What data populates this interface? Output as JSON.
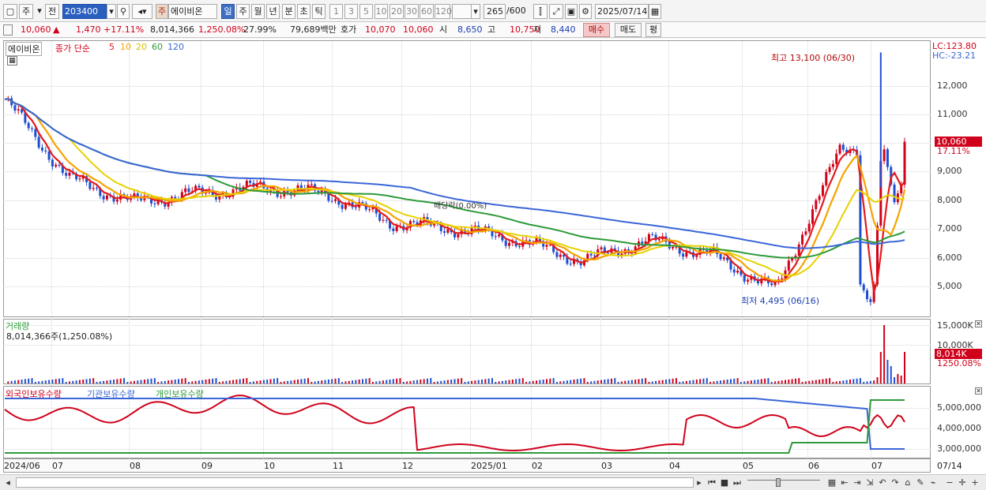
{
  "toolbar": {
    "period_tabs": [
      "주",
      "전"
    ],
    "code": "203400",
    "stock_badge": "주",
    "stock_name": "에이비온",
    "interval_tabs": [
      "일",
      "주",
      "월",
      "년",
      "분",
      "초",
      "틱"
    ],
    "selected_interval": "일",
    "unit_options": [
      "1",
      "3",
      "5",
      "10",
      "20",
      "30",
      "60",
      "120"
    ],
    "count": "265",
    "count_max": "/600",
    "date": "2025/07/14"
  },
  "quote": {
    "price": "10,060",
    "change_arrow": "▲",
    "change": "1,470",
    "change_pct": "+17.11%",
    "volume": "8,014,366",
    "volume_ratio": "1,250.08%",
    "turnover": "27.99%",
    "amount": "79,689백만",
    "ask_label": "호가",
    "ask": "10,070",
    "bid": "10,060",
    "open_label": "시",
    "open": "8,650",
    "high_label": "고",
    "high": "10,750",
    "low_label": "저",
    "low": "8,440",
    "buy_btn": "매수",
    "sell_btn": "매도",
    "eval_btn": "평"
  },
  "price_panel": {
    "name_tag": "에이비온",
    "legend_prefix": "종가 단순",
    "ma_labels": [
      "5",
      "10",
      "20",
      "60",
      "120"
    ],
    "ma_colors": [
      "#e31a1c",
      "#f5a300",
      "#e6d200",
      "#2e9a3a",
      "#3a66d8"
    ],
    "lc": "LC:123.80",
    "hc": "HC:-23.21",
    "y_labels": [
      "12,000",
      "11,000",
      "10,000",
      "9,000",
      "8,000",
      "7,000",
      "6,000",
      "5,000"
    ],
    "high_note": "최고 13,100 (06/30)",
    "low_note": "최저 4,495 (06/16)",
    "event_note": "배당락(0.00%)",
    "price_tag": "10,060",
    "pct_tag": "17.11%"
  },
  "volume_panel": {
    "title": "거래량",
    "value_line": "8,014,366주(1,250.08%)",
    "y_labels": [
      "15,000K",
      "10,000K"
    ],
    "vol_tag": "8,014K",
    "vol_pct_tag": "1250.08%"
  },
  "holding_panel": {
    "legend": [
      "외국인보유수량",
      "기관보유수량",
      "개인보유수량"
    ],
    "legend_colors": [
      "#d0021b",
      "#3a66d8",
      "#2e9a3a"
    ],
    "y_labels": [
      "5,000,000",
      "4,000,000",
      "3,000,000"
    ]
  },
  "x_axis": {
    "labels": [
      "2024/06",
      "07",
      "08",
      "09",
      "10",
      "11",
      "12",
      "2025/01",
      "02",
      "03",
      "04",
      "05",
      "06",
      "07",
      "07/14"
    ]
  },
  "chart_data": {
    "type": "line",
    "title": "",
    "price_series_approx": {
      "x": [
        "2024/06",
        "07",
        "08",
        "09",
        "10",
        "11",
        "12",
        "2025/01",
        "02",
        "03",
        "04",
        "05",
        "06",
        "06/30",
        "07/14"
      ],
      "close": [
        11500,
        8800,
        8000,
        8300,
        8500,
        8300,
        7300,
        7100,
        6700,
        6000,
        6700,
        6200,
        5000,
        9800,
        10060
      ]
    },
    "ylim": [
      4300,
      13300
    ]
  }
}
